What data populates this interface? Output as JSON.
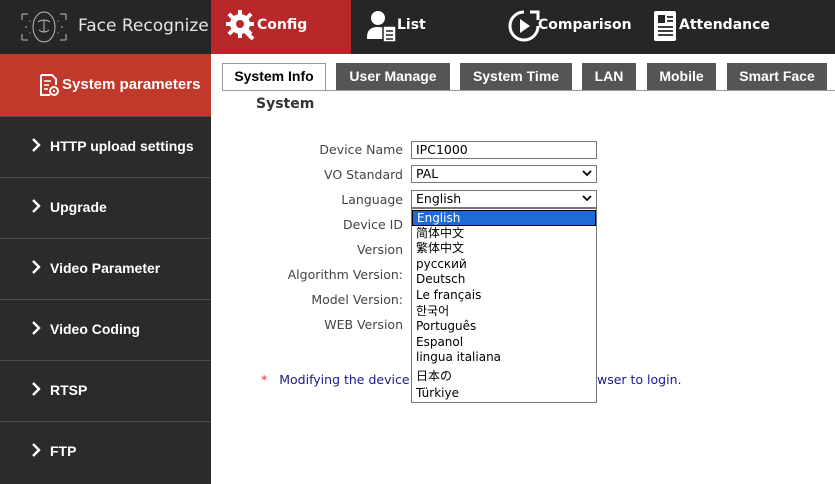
{
  "app": {
    "title": "Face Recognize"
  },
  "nav": {
    "items": [
      {
        "label": "Config",
        "icon": "gear-icon",
        "active": true
      },
      {
        "label": "List",
        "icon": "user-list-icon"
      },
      {
        "label": "Comparison",
        "icon": "comparison-icon"
      },
      {
        "label": "Attendance",
        "icon": "attendance-icon"
      }
    ]
  },
  "sidebar": {
    "header": "System parameters",
    "items": [
      {
        "label": "HTTP upload settings"
      },
      {
        "label": "Upgrade"
      },
      {
        "label": "Video Parameter"
      },
      {
        "label": "Video Coding"
      },
      {
        "label": "RTSP"
      },
      {
        "label": "FTP"
      }
    ]
  },
  "tabs": [
    {
      "label": "System Info",
      "active": true
    },
    {
      "label": "User Manage"
    },
    {
      "label": "System Time"
    },
    {
      "label": "LAN"
    },
    {
      "label": "Mobile"
    },
    {
      "label": "Smart Face"
    }
  ],
  "form": {
    "section_title": "System",
    "device_name": {
      "label": "Device Name",
      "value": "IPC1000"
    },
    "vo_standard": {
      "label": "VO Standard",
      "value": "PAL"
    },
    "language": {
      "label": "Language",
      "value": "English"
    },
    "device_id": {
      "label": "Device ID"
    },
    "version": {
      "label": "Version"
    },
    "algorithm_version": {
      "label": "Algorithm Version:"
    },
    "model_version": {
      "label": "Model Version:"
    },
    "web_version": {
      "label": "WEB Version"
    }
  },
  "language_options": [
    "English",
    "简体中文",
    "繁体中文",
    "русский",
    "Deutsch",
    "Le français",
    "한국어",
    "Português",
    "Espanol",
    "lingua italiana",
    "日本の",
    "Türkiye"
  ],
  "notice": {
    "star": "*",
    "text_visible_start": "Modifying the device l",
    "text_visible_end": "wser to login."
  },
  "colors": {
    "accent": "#c0392b",
    "topbar": "#262626",
    "sidebar": "#2b2b2b",
    "tab": "#555555",
    "selection": "#1e6ad6"
  }
}
